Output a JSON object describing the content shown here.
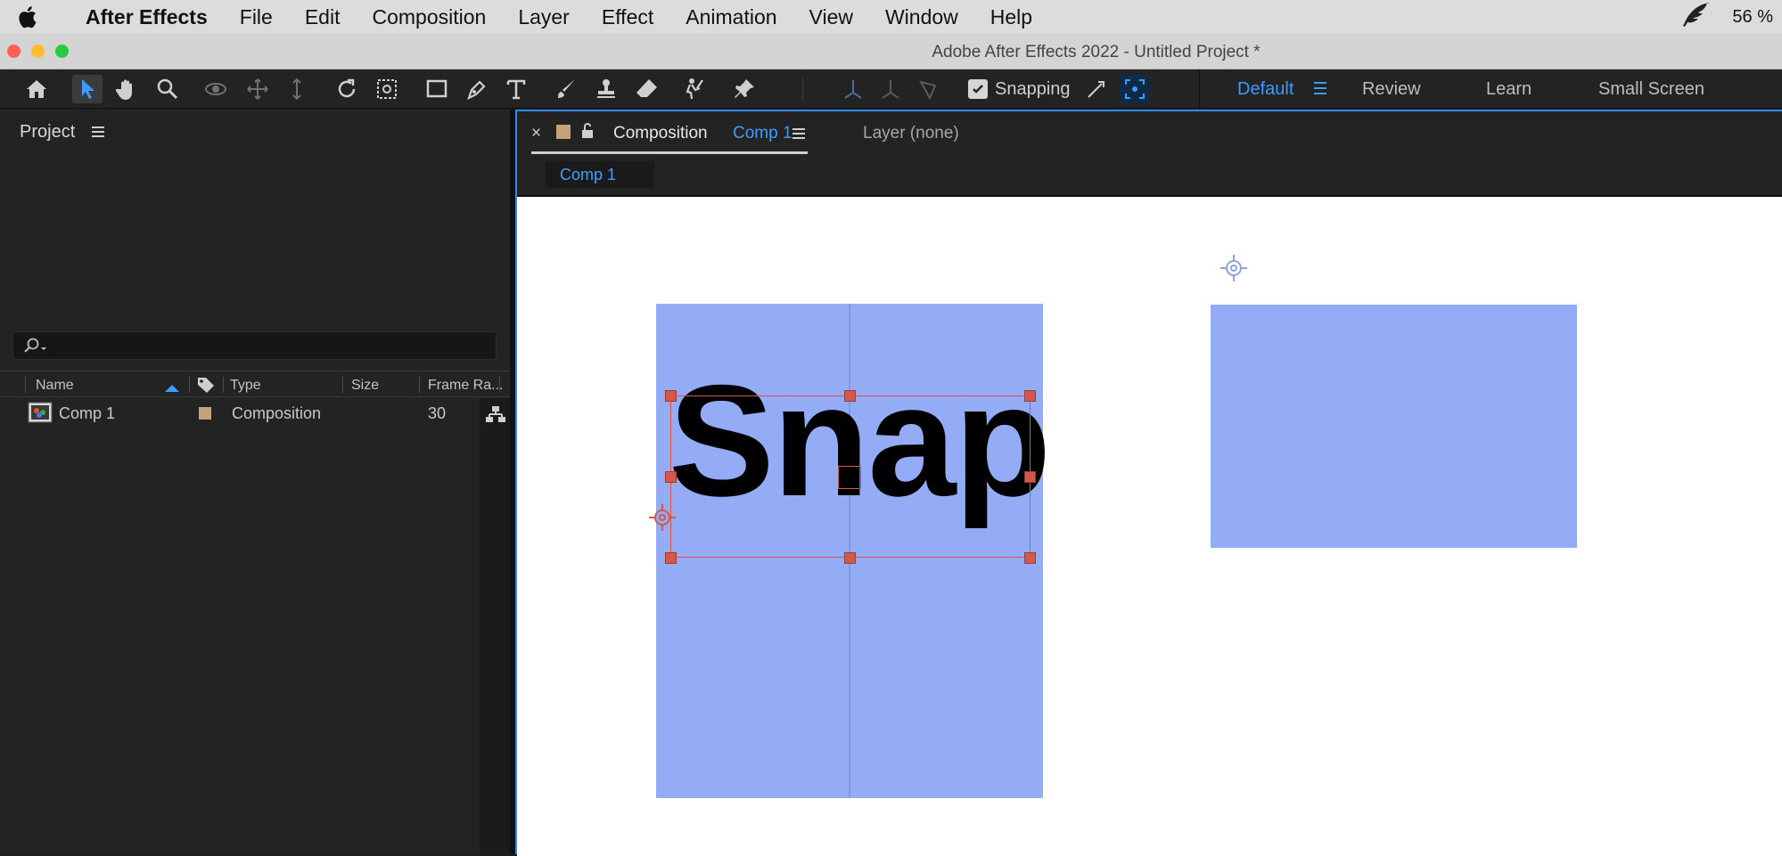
{
  "menubar": {
    "app_name": "After Effects",
    "items": [
      "File",
      "Edit",
      "Composition",
      "Layer",
      "Effect",
      "Animation",
      "View",
      "Window",
      "Help"
    ],
    "battery": "56 %"
  },
  "window": {
    "title": "Adobe After Effects 2022 - Untitled Project *"
  },
  "toolbar": {
    "snapping_label": "Snapping",
    "snapping_checked": true,
    "workspaces": [
      "Default",
      "Review",
      "Learn",
      "Small Screen"
    ],
    "active_workspace": "Default",
    "tools": [
      "home-icon",
      "selection-tool-icon",
      "hand-tool-icon",
      "zoom-tool-icon",
      "orbit-camera-icon",
      "pan-camera-icon",
      "dolly-camera-icon",
      "rotation-tool-icon",
      "pan-behind-tool-icon",
      "rectangle-tool-icon",
      "pen-tool-icon",
      "type-tool-icon",
      "brush-tool-icon",
      "clone-stamp-icon",
      "eraser-icon",
      "roto-brush-icon",
      "puppet-pin-icon"
    ]
  },
  "project_panel": {
    "title": "Project",
    "columns": [
      "Name",
      "Type",
      "Size",
      "Frame Ra..."
    ],
    "rows": [
      {
        "name": "Comp 1",
        "type": "Composition",
        "size": "",
        "frame_rate": "30",
        "label_color": "#c4a27c"
      }
    ]
  },
  "comp_panel": {
    "tab_prefix": "Composition",
    "tab_comp_name": "Comp 1",
    "layer_tab": "Layer (none)",
    "subtab": "Comp 1",
    "viewer": {
      "text_layer": "Snap",
      "solid_color": "#94acf6",
      "handle_color": "#d4574a"
    }
  }
}
